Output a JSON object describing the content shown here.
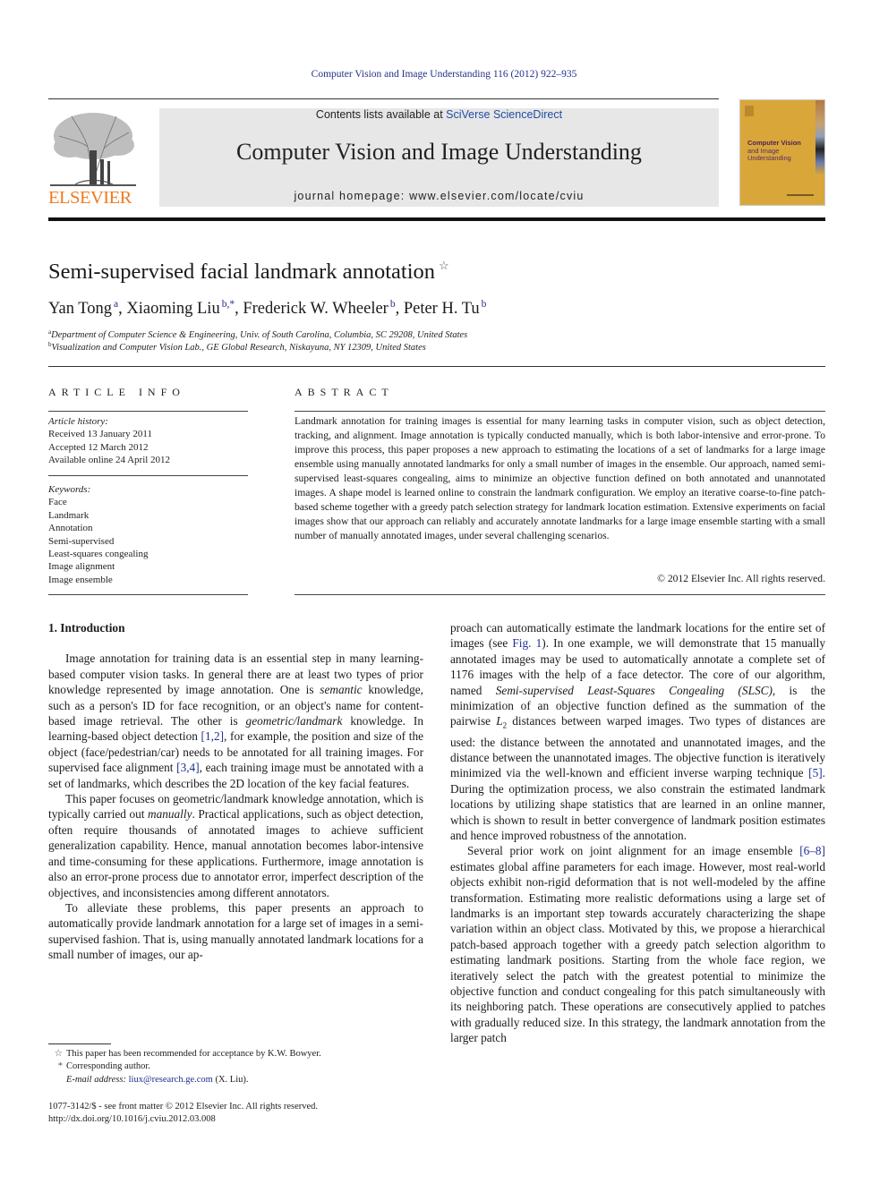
{
  "header": {
    "journal_reference": "Computer Vision and Image Understanding 116 (2012) 922–935",
    "contents_prefix": "Contents lists available at ",
    "contents_link": "SciVerse ScienceDirect",
    "journal_title": "Computer Vision and Image Understanding",
    "homepage": "journal homepage: www.elsevier.com/locate/cviu",
    "publisher_logo_text": "ELSEVIER",
    "cover": {
      "title_line1": "Computer Vision",
      "title_line2": "and Image",
      "title_line3": "Understanding",
      "color": "#d9a63a"
    }
  },
  "article": {
    "title": "Semi-supervised facial landmark annotation",
    "title_note_mark": "☆",
    "authors": [
      {
        "name": "Yan Tong",
        "sup": "a"
      },
      {
        "name": "Xiaoming Liu",
        "sup": "b,*"
      },
      {
        "name": "Frederick W. Wheeler",
        "sup": "b"
      },
      {
        "name": "Peter H. Tu",
        "sup": "b"
      }
    ],
    "author_separator": ", ",
    "affiliations": [
      {
        "mark": "a",
        "text": "Department of Computer Science & Engineering, Univ. of South Carolina, Columbia, SC 29208, United States"
      },
      {
        "mark": "b",
        "text": "Visualization and Computer Vision Lab., GE Global Research, Niskayuna, NY 12309, United States"
      }
    ]
  },
  "article_info": {
    "heading": "ARTICLE INFO",
    "history_label": "Article history:",
    "history": [
      "Received 13 January 2011",
      "Accepted 12 March 2012",
      "Available online 24 April 2012"
    ],
    "keywords_label": "Keywords:",
    "keywords": [
      "Face",
      "Landmark",
      "Annotation",
      "Semi-supervised",
      "Least-squares congealing",
      "Image alignment",
      "Image ensemble"
    ]
  },
  "abstract": {
    "heading": "ABSTRACT",
    "text": "Landmark annotation for training images is essential for many learning tasks in computer vision, such as object detection, tracking, and alignment. Image annotation is typically conducted manually, which is both labor-intensive and error-prone. To improve this process, this paper proposes a new approach to estimating the locations of a set of landmarks for a large image ensemble using manually annotated landmarks for only a small number of images in the ensemble. Our approach, named semi-supervised least-squares congealing, aims to minimize an objective function defined on both annotated and unannotated images. A shape model is learned online to constrain the landmark configuration. We employ an iterative coarse-to-fine patch-based scheme together with a greedy patch selection strategy for landmark location estimation. Extensive experiments on facial images show that our approach can reliably and accurately annotate landmarks for a large image ensemble starting with a small number of manually annotated images, under several challenging scenarios.",
    "copyright": "© 2012 Elsevier Inc. All rights reserved."
  },
  "body": {
    "intro_heading": "1. Introduction",
    "left_paragraphs": [
      [
        {
          "t": "Image annotation for training data is an essential step in many learning-based computer vision tasks. In general there are at least two types of prior knowledge represented by image annotation. One is "
        },
        {
          "t": "semantic",
          "i": true
        },
        {
          "t": " knowledge, such as a person's ID for face recognition, or an object's name for content-based image retrieval. The other is "
        },
        {
          "t": "geometric/landmark",
          "i": true
        },
        {
          "t": " knowledge. In learning-based object detection "
        },
        {
          "t": "[1,2]",
          "r": true
        },
        {
          "t": ", for example, the position and size of the object (face/pedestrian/car) needs to be annotated for all training images. For supervised face alignment "
        },
        {
          "t": "[3,4]",
          "r": true
        },
        {
          "t": ", each training image must be annotated with a set of landmarks, which describes the 2D location of the key facial features."
        }
      ],
      [
        {
          "t": "This paper focuses on geometric/landmark knowledge annotation, which is typically carried out "
        },
        {
          "t": "manually",
          "i": true
        },
        {
          "t": ". Practical applications, such as object detection, often require thousands of annotated images to achieve sufficient generalization capability. Hence, manual annotation becomes labor-intensive and time-consuming for these applications. Furthermore, image annotation is also an error-prone process due to annotator error, imperfect description of the objectives, and inconsistencies among different annotators."
        }
      ],
      [
        {
          "t": "To alleviate these problems, this paper presents an approach to automatically provide landmark annotation for a large set of images in a semi-supervised fashion. That is, using manually annotated landmark locations for a small number of images, our ap-"
        }
      ]
    ],
    "right_paragraphs": [
      [
        {
          "t": "proach can automatically estimate the landmark locations for the entire set of images (see "
        },
        {
          "t": "Fig. 1",
          "r": true
        },
        {
          "t": "). In one example, we will demonstrate that 15 manually annotated images may be used to automatically annotate a complete set of 1176 images with the help of a face detector. The core of our algorithm, named "
        },
        {
          "t": "Semi-supervised Least-Squares Congealing (SLSC)",
          "i": true
        },
        {
          "t": ", is the minimization of an objective function defined as the summation of the pairwise "
        },
        {
          "t": "L",
          "i": true
        },
        {
          "t": "2",
          "sub": true
        },
        {
          "t": " distances between warped images. Two types of distances are used: the distance between the annotated and unannotated images, and the distance between the unannotated images. The objective function is iteratively minimized via the well-known and efficient inverse warping technique "
        },
        {
          "t": "[5]",
          "r": true
        },
        {
          "t": ". During the optimization process, we also constrain the estimated landmark locations by utilizing shape statistics that are learned in an online manner, which is shown to result in better convergence of landmark position estimates and hence improved robustness of the annotation."
        }
      ],
      [
        {
          "t": "Several prior work on joint alignment for an image ensemble "
        },
        {
          "t": "[6–8]",
          "r": true
        },
        {
          "t": " estimates global affine parameters for each image. However, most real-world objects exhibit non-rigid deformation that is not well-modeled by the affine transformation. Estimating more realistic deformations using a large set of landmarks is an important step towards accurately characterizing the shape variation within an object class. Motivated by this, we propose a hierarchical patch-based approach together with a greedy patch selection algorithm to estimating landmark positions. Starting from the whole face region, we iteratively select the patch with the greatest potential to minimize the objective function and conduct congealing for this patch simultaneously with its neighboring patch. These operations are consecutively applied to patches with gradually reduced size. In this strategy, the landmark annotation from the larger patch"
        }
      ]
    ]
  },
  "footnotes": {
    "note1_mark": "☆",
    "note1": "This paper has been recommended for acceptance by K.W. Bowyer.",
    "note2_mark": "*",
    "note2": "Corresponding author.",
    "email_label": "E-mail address:",
    "email": "liux@research.ge.com",
    "email_suffix": " (X. Liu).",
    "issn_line": "1077-3142/$ - see front matter © 2012 Elsevier Inc. All rights reserved.",
    "doi": "http://dx.doi.org/10.1016/j.cviu.2012.03.008"
  }
}
